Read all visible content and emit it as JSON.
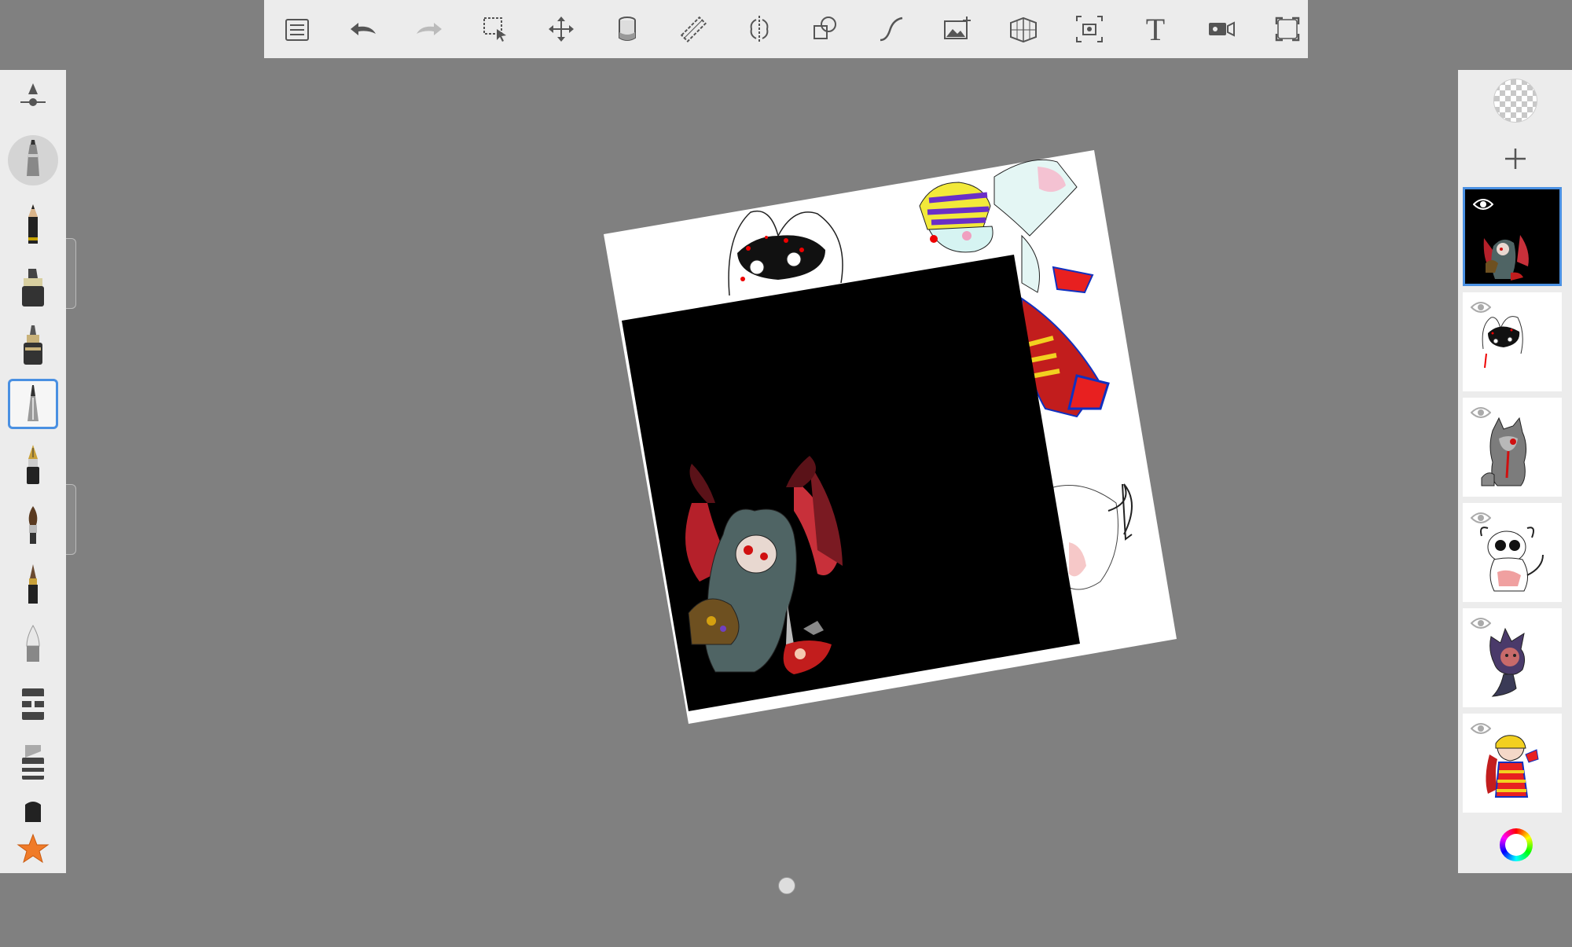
{
  "toolbar": {
    "groups": [
      [
        {
          "name": "menu-list-icon"
        },
        {
          "name": "undo-icon"
        },
        {
          "name": "redo-icon"
        }
      ],
      [
        {
          "name": "selection-icon"
        },
        {
          "name": "transform-move-icon"
        },
        {
          "name": "fill-bucket-icon"
        },
        {
          "name": "ruler-icon"
        },
        {
          "name": "symmetry-icon"
        },
        {
          "name": "shapes-icon"
        },
        {
          "name": "stroke-curve-icon"
        },
        {
          "name": "add-image-icon"
        },
        {
          "name": "perspective-grid-icon"
        },
        {
          "name": "canvas-resize-icon"
        },
        {
          "name": "text-tool-icon",
          "text": "T"
        },
        {
          "name": "time-lapse-video-icon"
        }
      ],
      [
        {
          "name": "fullscreen-icon"
        }
      ]
    ]
  },
  "brushes": {
    "items": [
      {
        "name": "brush-properties-icon"
      },
      {
        "name": "brush-airbrush-icon",
        "state": "active"
      },
      {
        "name": "brush-pencil-icon"
      },
      {
        "name": "brush-marker-icon"
      },
      {
        "name": "brush-ballpoint-pen-icon"
      },
      {
        "name": "brush-technical-pen-icon",
        "state": "selected"
      },
      {
        "name": "brush-fountain-pen-icon"
      },
      {
        "name": "brush-paintbrush-icon"
      },
      {
        "name": "brush-ink-brush-icon"
      },
      {
        "name": "brush-soft-eraser-icon"
      },
      {
        "name": "brush-chisel-marker-icon"
      },
      {
        "name": "brush-smear-icon"
      },
      {
        "name": "brush-hard-eraser-icon"
      },
      {
        "name": "favorites-star-icon"
      }
    ]
  },
  "layers": {
    "items": [
      {
        "name": "layer-1",
        "background": "#000000",
        "selected": true,
        "visible": true
      },
      {
        "name": "layer-2",
        "background": "#ffffff",
        "selected": false,
        "visible": true
      },
      {
        "name": "layer-3",
        "background": "#ffffff",
        "selected": false,
        "visible": true
      },
      {
        "name": "layer-4",
        "background": "#ffffff",
        "selected": false,
        "visible": true
      },
      {
        "name": "layer-5",
        "background": "#ffffff",
        "selected": false,
        "visible": true
      },
      {
        "name": "layer-6",
        "background": "#ffffff",
        "selected": false,
        "visible": true
      }
    ]
  },
  "colors": {
    "workspace": "#808080",
    "panel": "#ececec",
    "selection_accent": "#4a90e2",
    "canvas_paper": "#ffffff",
    "canvas_layer_fill": "#000000"
  }
}
